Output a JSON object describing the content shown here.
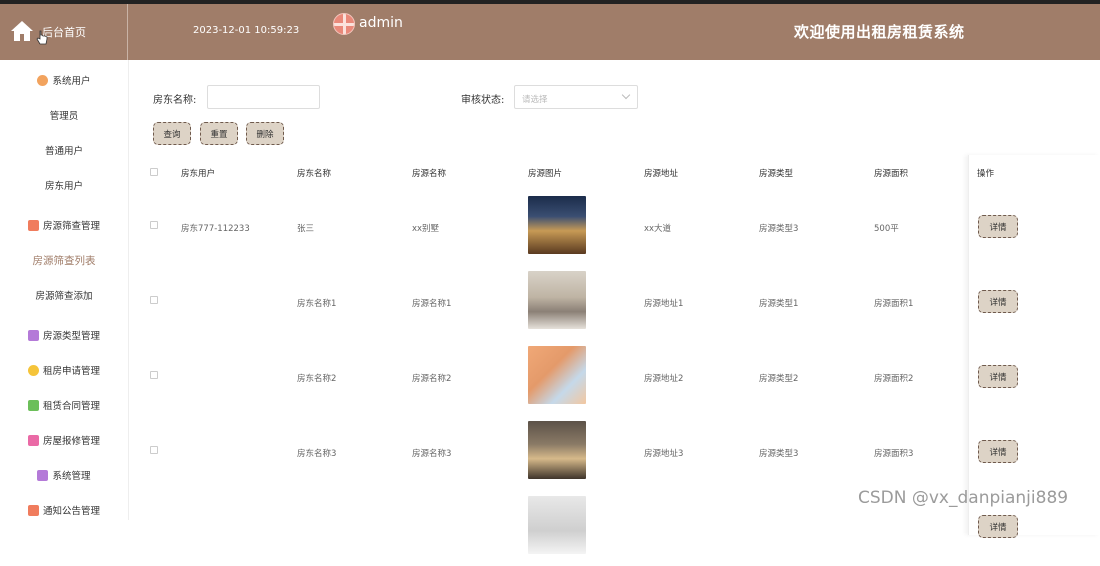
{
  "header": {
    "home_label": "后台首页",
    "datetime": "2023-12-01 10:59:23",
    "user": "admin",
    "system_title": "欢迎使用出租房租赁系统"
  },
  "sidebar": {
    "items": [
      {
        "label": "系统用户",
        "icon": "gear-icon",
        "color": "#f2a35e",
        "type": "group"
      },
      {
        "label": "管理员",
        "type": "sub"
      },
      {
        "label": "普通用户",
        "type": "sub"
      },
      {
        "label": "房东用户",
        "type": "sub"
      },
      {
        "label": "房源筛查管理",
        "icon": "grid-icon",
        "color": "#f07c5d",
        "type": "group"
      },
      {
        "label": "房源筛查列表",
        "type": "sub",
        "active": true
      },
      {
        "label": "房源筛查添加",
        "type": "sub"
      },
      {
        "label": "房源类型管理",
        "icon": "box-icon",
        "color": "#b47ad8",
        "type": "group"
      },
      {
        "label": "租房申请管理",
        "icon": "sun-icon",
        "color": "#f5c43a",
        "type": "group"
      },
      {
        "label": "租赁合同管理",
        "icon": "message-icon",
        "color": "#6cbf5a",
        "type": "group"
      },
      {
        "label": "房屋报修管理",
        "icon": "doc-icon",
        "color": "#ea6aa6",
        "type": "group"
      },
      {
        "label": "系统管理",
        "icon": "box-icon",
        "color": "#b47ad8",
        "type": "group"
      },
      {
        "label": "通知公告管理",
        "icon": "grid-icon",
        "color": "#f07c5d",
        "type": "group"
      }
    ]
  },
  "filters": {
    "landlord_name_label": "房东名称:",
    "landlord_name_value": "",
    "status_label": "审核状态:",
    "status_placeholder": "请选择"
  },
  "buttons": {
    "query": "查询",
    "reset": "重置",
    "delete": "删除"
  },
  "table": {
    "columns": [
      "房东用户",
      "房东名称",
      "房源名称",
      "房源图片",
      "房源地址",
      "房源类型",
      "房源面积"
    ],
    "ops_header": "操作",
    "detail_label": "详情",
    "rows": [
      {
        "landlord_user": "房东777-112233",
        "landlord_name": "张三",
        "property_name": "xx别墅",
        "image": "villa-night-photo",
        "address": "xx大道",
        "type": "房源类型3",
        "area": "500平"
      },
      {
        "landlord_user": "",
        "landlord_name": "房东名称1",
        "property_name": "房源名称1",
        "image": "living-room-photo",
        "address": "房源地址1",
        "type": "房源类型1",
        "area": "房源面积1"
      },
      {
        "landlord_user": "",
        "landlord_name": "房东名称2",
        "property_name": "房源名称2",
        "image": "kids-bedroom-photo",
        "address": "房源地址2",
        "type": "房源类型2",
        "area": "房源面积2"
      },
      {
        "landlord_user": "",
        "landlord_name": "房东名称3",
        "property_name": "房源名称3",
        "image": "bedroom-photo",
        "address": "房源地址3",
        "type": "房源类型3",
        "area": "房源面积3"
      },
      {
        "landlord_user": "",
        "landlord_name": "",
        "property_name": "",
        "image": "white-room-photo",
        "address": "",
        "type": "",
        "area": ""
      }
    ]
  },
  "watermark": "CSDN @vx_danpianji889",
  "colors": {
    "header_bg": "#a07d69",
    "button_bg": "#ddd3c6",
    "active_menu": "#a07d69"
  }
}
